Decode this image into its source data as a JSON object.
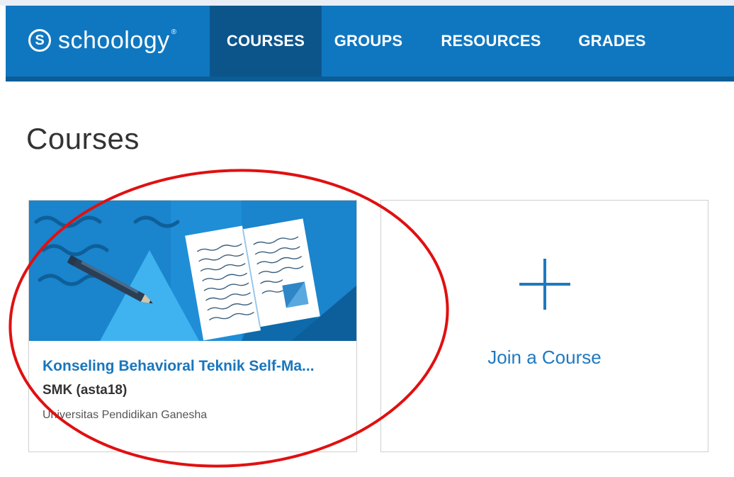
{
  "app": {
    "logo_mark": "S",
    "logo_text": "schoology",
    "logo_trademark": "®"
  },
  "nav": {
    "tabs": [
      {
        "label": "COURSES",
        "active": true
      },
      {
        "label": "GROUPS",
        "active": false
      },
      {
        "label": "RESOURCES",
        "active": false
      },
      {
        "label": "GRADES",
        "active": false
      }
    ]
  },
  "page": {
    "title": "Courses"
  },
  "courses": [
    {
      "title": "Konseling Behavioral Teknik Self-Ma...",
      "section": "SMK (asta18)",
      "school": "Universitas Pendidikan Ganesha",
      "illustration": "open-book-and-pencil"
    }
  ],
  "join_card": {
    "label": "Join a Course",
    "icon": "plus-icon"
  },
  "colors": {
    "nav_bg": "#0f77c0",
    "nav_active": "#0c558b",
    "link": "#1976bd",
    "annotation": "#e01010"
  },
  "annotation": {
    "shape": "red-ellipse",
    "target": "course-card"
  }
}
